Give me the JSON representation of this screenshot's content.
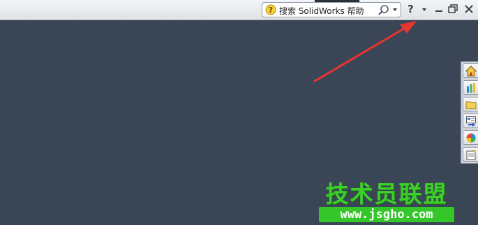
{
  "search": {
    "label": "搜索 SolidWorks 帮助"
  },
  "help": {
    "label": "?"
  },
  "window_controls": [
    "minimize-icon",
    "restore-icon",
    "close-icon"
  ],
  "colors": {
    "workspace": "#3a4556",
    "titlebar": "#e8eaee",
    "annotation_arrow": "#e8352e",
    "watermark": "#3bd12a"
  },
  "task_pane": {
    "tabs": [
      {
        "name": "home-icon"
      },
      {
        "name": "design-library-icon"
      },
      {
        "name": "file-explorer-icon"
      },
      {
        "name": "view-palette-icon"
      },
      {
        "name": "appearances-icon"
      },
      {
        "name": "custom-properties-icon"
      }
    ]
  },
  "watermark": {
    "title": "技术员联盟",
    "url": "www.jsgho.com"
  }
}
